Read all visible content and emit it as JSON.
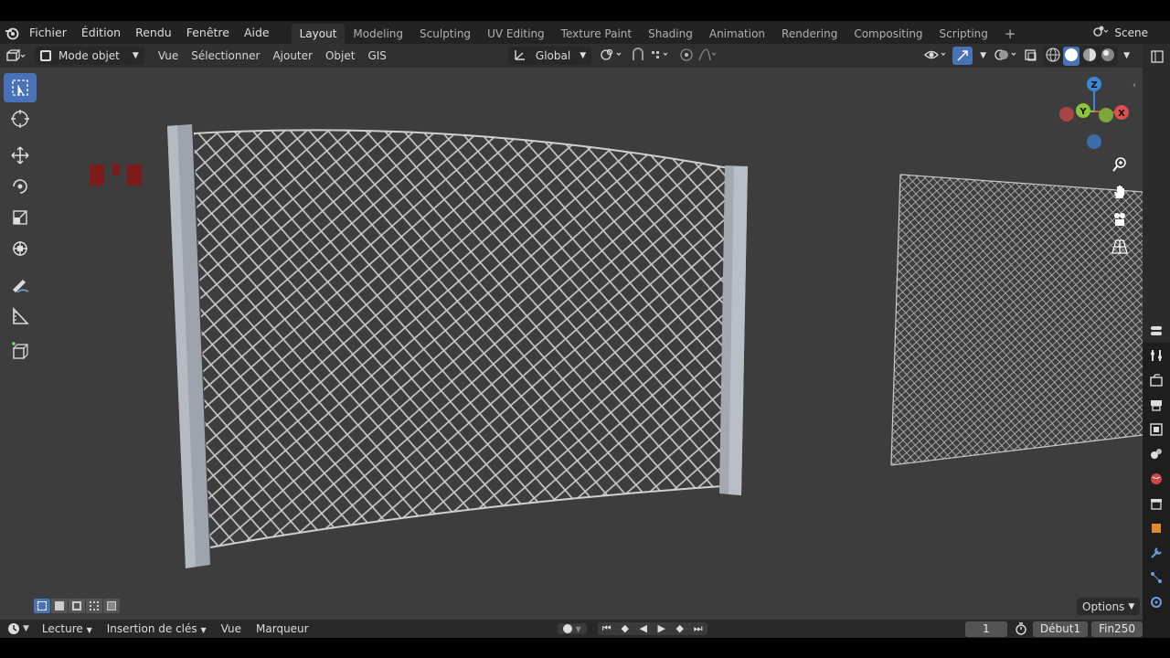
{
  "menu": {
    "items": [
      "Fichier",
      "Édition",
      "Rendu",
      "Fenêtre",
      "Aide"
    ]
  },
  "workspaces": {
    "tabs": [
      "Layout",
      "Modeling",
      "Sculpting",
      "UV Editing",
      "Texture Paint",
      "Shading",
      "Animation",
      "Rendering",
      "Compositing",
      "Scripting"
    ],
    "active": "Layout",
    "add_label": "+"
  },
  "scene": {
    "label": "Scene"
  },
  "header": {
    "mode": "Mode objet",
    "items": [
      "Vue",
      "Sélectionner",
      "Ajouter",
      "Objet",
      "GIS"
    ],
    "orientation": "Global"
  },
  "gizmo": {
    "z": "Z",
    "y": "Y",
    "x": "X"
  },
  "viewport_options": {
    "label": "Options"
  },
  "timeline": {
    "playback": "Lecture",
    "keying": "Insertion de clés",
    "view": "Vue",
    "marker": "Marqueur",
    "current_frame": "1",
    "start_label": "Début",
    "start": "1",
    "end_label": "Fin",
    "end": "250"
  },
  "colors": {
    "accent": "#4a72b8",
    "axis_x": "#e05050",
    "axis_y": "#8cc43a",
    "axis_z": "#3d88d6"
  }
}
